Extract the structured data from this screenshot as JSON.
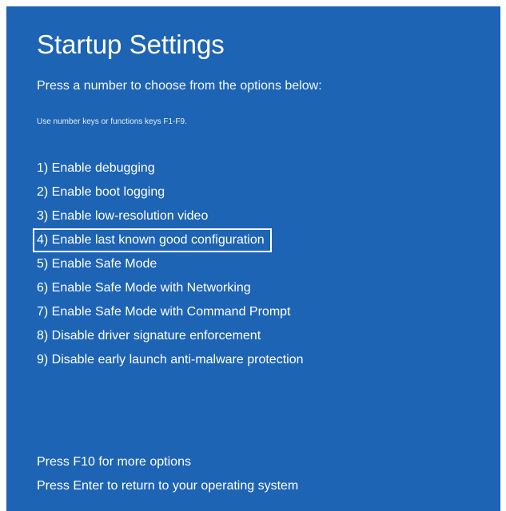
{
  "title": "Startup Settings",
  "prompt": "Press a number to choose from the options below:",
  "hint": "Use number keys or functions keys F1-F9.",
  "options": [
    {
      "label": "1) Enable debugging"
    },
    {
      "label": "2) Enable boot logging"
    },
    {
      "label": "3) Enable low-resolution video"
    },
    {
      "label": "4) Enable last known good configuration",
      "selected": true
    },
    {
      "label": "5) Enable Safe Mode"
    },
    {
      "label": "6) Enable Safe Mode with Networking"
    },
    {
      "label": "7) Enable Safe Mode with Command Prompt"
    },
    {
      "label": "8) Disable driver signature enforcement"
    },
    {
      "label": "9) Disable early launch anti-malware protection"
    }
  ],
  "footer": {
    "more_options": "Press F10 for more options",
    "return": "Press Enter to return to your operating system"
  },
  "colors": {
    "background": "#1e64b4",
    "text": "#ffffff",
    "highlight_border": "#ffffff"
  }
}
